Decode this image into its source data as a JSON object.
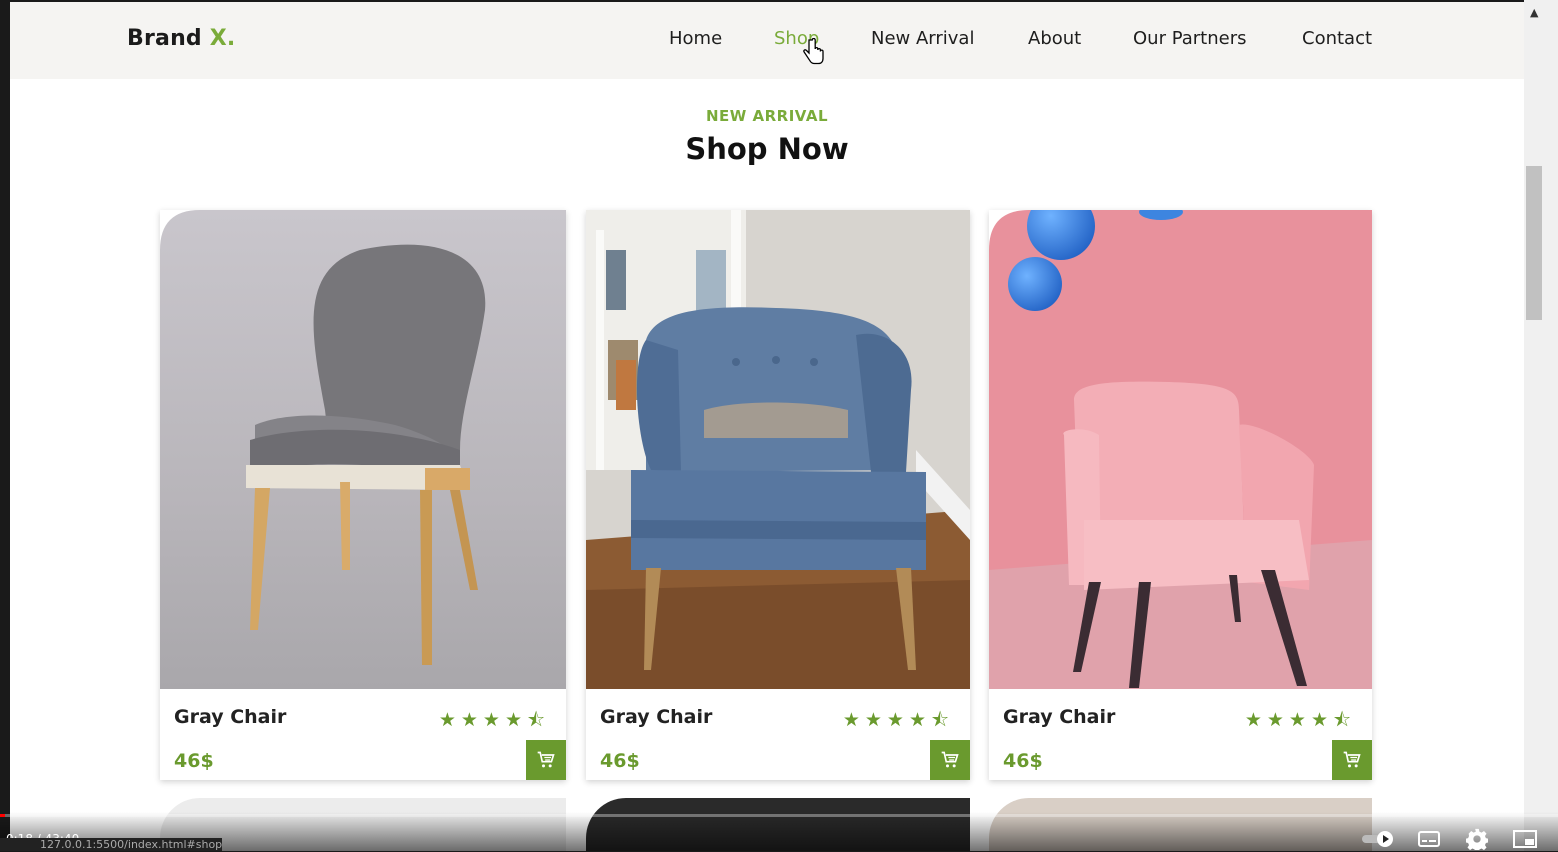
{
  "brand": {
    "name": "Brand",
    "accent": "X."
  },
  "nav": {
    "items": [
      {
        "label": "Home",
        "active": false
      },
      {
        "label": "Shop",
        "active": true
      },
      {
        "label": "New Arrival",
        "active": false
      },
      {
        "label": "About",
        "active": false
      },
      {
        "label": "Our Partners",
        "active": false
      },
      {
        "label": "Contact",
        "active": false
      }
    ]
  },
  "section": {
    "subtitle": "NEW ARRIVAL",
    "heading": "Shop Now"
  },
  "products": [
    {
      "name": "Gray Chair",
      "price": "46$",
      "rating": 4.5,
      "stars": "★★★★⯪",
      "photo": "gray-chair"
    },
    {
      "name": "Gray Chair",
      "price": "46$",
      "rating": 4.5,
      "stars": "★★★★⯪",
      "photo": "blue-armchair"
    },
    {
      "name": "Gray Chair",
      "price": "46$",
      "rating": 4.5,
      "stars": "★★★★⯪",
      "photo": "pink-armchair"
    }
  ],
  "video": {
    "time": "0:18 / 43:40",
    "progress": 0.007
  },
  "status_url": "127.0.0.1:5500/index.html#shop",
  "colors": {
    "accent": "#7aab3a",
    "button": "#6a9a2e",
    "nav_bg": "#f5f4f2"
  }
}
